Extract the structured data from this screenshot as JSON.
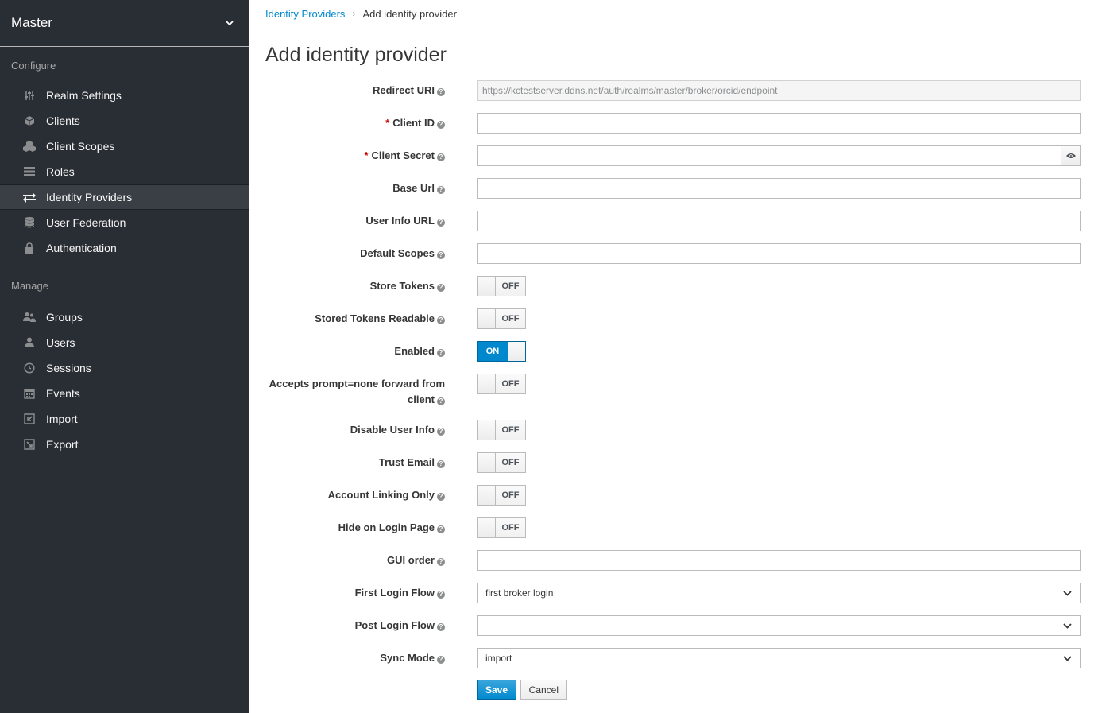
{
  "sidebar": {
    "realm": "Master",
    "configure_label": "Configure",
    "manage_label": "Manage",
    "configure_items": [
      {
        "label": "Realm Settings",
        "icon": "sliders-icon"
      },
      {
        "label": "Clients",
        "icon": "cube-icon"
      },
      {
        "label": "Client Scopes",
        "icon": "cubes-icon"
      },
      {
        "label": "Roles",
        "icon": "list-icon"
      },
      {
        "label": "Identity Providers",
        "icon": "exchange-icon"
      },
      {
        "label": "User Federation",
        "icon": "database-icon"
      },
      {
        "label": "Authentication",
        "icon": "lock-icon"
      }
    ],
    "manage_items": [
      {
        "label": "Groups",
        "icon": "users-icon"
      },
      {
        "label": "Users",
        "icon": "user-icon"
      },
      {
        "label": "Sessions",
        "icon": "clock-icon"
      },
      {
        "label": "Events",
        "icon": "calendar-icon"
      },
      {
        "label": "Import",
        "icon": "import-icon"
      },
      {
        "label": "Export",
        "icon": "export-icon"
      }
    ],
    "active": "Identity Providers"
  },
  "breadcrumb": {
    "parent": "Identity Providers",
    "separator": "›",
    "current": "Add identity provider"
  },
  "page_title": "Add identity provider",
  "form": {
    "redirect_uri": {
      "label": "Redirect URI",
      "value": "https://kctestserver.ddns.net/auth/realms/master/broker/orcid/endpoint"
    },
    "client_id": {
      "label": "Client ID",
      "required_mark": "*",
      "value": ""
    },
    "client_secret": {
      "label": "Client Secret",
      "required_mark": "*",
      "value": ""
    },
    "base_url": {
      "label": "Base Url",
      "value": ""
    },
    "user_info_url": {
      "label": "User Info URL",
      "value": ""
    },
    "default_scopes": {
      "label": "Default Scopes",
      "value": ""
    },
    "store_tokens": {
      "label": "Store Tokens",
      "state": "OFF"
    },
    "stored_tokens_readable": {
      "label": "Stored Tokens Readable",
      "state": "OFF"
    },
    "enabled": {
      "label": "Enabled",
      "state": "ON"
    },
    "accepts_prompt": {
      "label_line1": "Accepts prompt=none forward from",
      "label_line2": "client",
      "state": "OFF"
    },
    "disable_user_info": {
      "label": "Disable User Info",
      "state": "OFF"
    },
    "trust_email": {
      "label": "Trust Email",
      "state": "OFF"
    },
    "account_linking_only": {
      "label": "Account Linking Only",
      "state": "OFF"
    },
    "hide_on_login_page": {
      "label": "Hide on Login Page",
      "state": "OFF"
    },
    "gui_order": {
      "label": "GUI order",
      "value": ""
    },
    "first_login_flow": {
      "label": "First Login Flow",
      "value": "first broker login"
    },
    "post_login_flow": {
      "label": "Post Login Flow",
      "value": ""
    },
    "sync_mode": {
      "label": "Sync Mode",
      "value": "import"
    },
    "help_glyph": "?",
    "save_label": "Save",
    "cancel_label": "Cancel"
  },
  "colors": {
    "sidebar_bg": "#292e34",
    "accent": "#0088ce",
    "required": "#cc0000"
  }
}
